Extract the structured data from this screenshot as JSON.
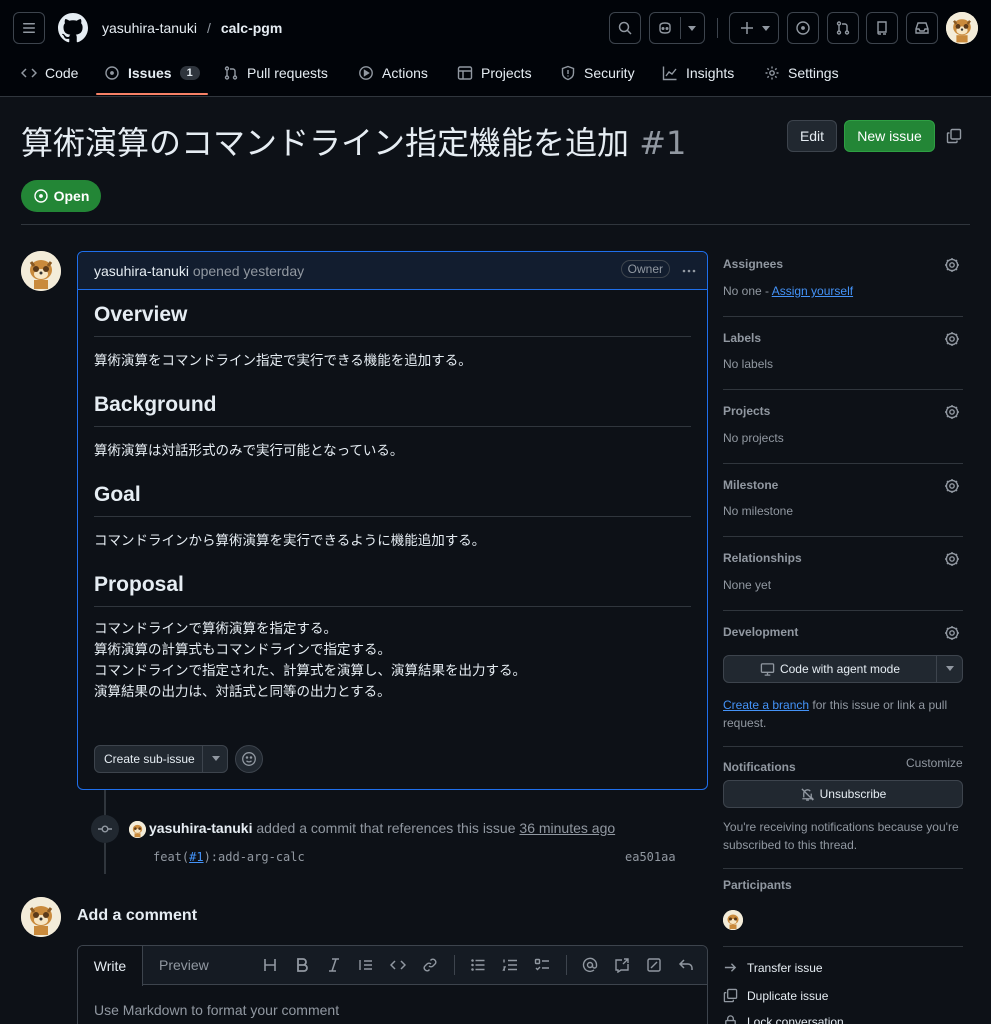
{
  "header": {
    "owner": "yasuhira-tanuki",
    "separator": "/",
    "repo": "calc-pgm",
    "tabs": [
      {
        "label": "Code",
        "icon": "code-icon"
      },
      {
        "label": "Issues",
        "icon": "issue-opened-icon",
        "count": "1",
        "selected": true
      },
      {
        "label": "Pull requests",
        "icon": "git-pull-request-icon"
      },
      {
        "label": "Actions",
        "icon": "play-icon"
      },
      {
        "label": "Projects",
        "icon": "table-icon"
      },
      {
        "label": "Security",
        "icon": "shield-icon"
      },
      {
        "label": "Insights",
        "icon": "graph-icon"
      },
      {
        "label": "Settings",
        "icon": "gear-icon"
      }
    ]
  },
  "issue": {
    "title": "算術演算のコマンドライン指定機能を追加",
    "number": "#1",
    "state": "Open",
    "edit_label": "Edit",
    "new_issue_label": "New issue"
  },
  "comment": {
    "author": "yasuhira-tanuki",
    "meta": "opened yesterday",
    "badge": "Owner",
    "sections": [
      {
        "heading": "Overview",
        "lines": [
          "算術演算をコマンドライン指定で実行できる機能を追加する。"
        ]
      },
      {
        "heading": "Background",
        "lines": [
          "算術演算は対話形式のみで実行可能となっている。"
        ]
      },
      {
        "heading": "Goal",
        "lines": [
          "コマンドラインから算術演算を実行できるように機能追加する。"
        ]
      },
      {
        "heading": "Proposal",
        "lines": [
          "コマンドラインで算術演算を指定する。",
          "算術演算の計算式もコマンドラインで指定する。",
          "コマンドラインで指定された、計算式を演算し、演算結果を出力する。",
          "演算結果の出力は、対話式と同等の出力とする。"
        ]
      }
    ],
    "sub_issue_label": "Create sub-issue"
  },
  "timeline": {
    "author": "yasuhira-tanuki",
    "action": "added a commit that references this issue",
    "time": "36 minutes ago",
    "commit_prefix": "feat(",
    "commit_ref": "#1",
    "commit_suffix": "):add-arg-calc",
    "sha": "ea501aa"
  },
  "new_comment": {
    "heading": "Add a comment",
    "tab_write": "Write",
    "tab_preview": "Preview",
    "placeholder": "Use Markdown to format your comment"
  },
  "sidebar": {
    "assignees": {
      "title": "Assignees",
      "value": "No one - ",
      "link": "Assign yourself"
    },
    "labels": {
      "title": "Labels",
      "value": "No labels"
    },
    "projects": {
      "title": "Projects",
      "value": "No projects"
    },
    "milestone": {
      "title": "Milestone",
      "value": "No milestone"
    },
    "relationships": {
      "title": "Relationships",
      "value": "None yet"
    },
    "development": {
      "title": "Development",
      "button": "Code with agent mode",
      "link": "Create a branch",
      "text": " for this issue or link a pull request."
    },
    "notifications": {
      "title": "Notifications",
      "customize": "Customize",
      "button": "Unsubscribe",
      "text": "You're receiving notifications because you're subscribed to this thread."
    },
    "participants": {
      "title": "Participants"
    },
    "actions": [
      "Transfer issue",
      "Duplicate issue",
      "Lock conversation"
    ]
  },
  "colors": {
    "accent": "#4493f8",
    "open": "#238636",
    "bg": "#0d1117"
  }
}
